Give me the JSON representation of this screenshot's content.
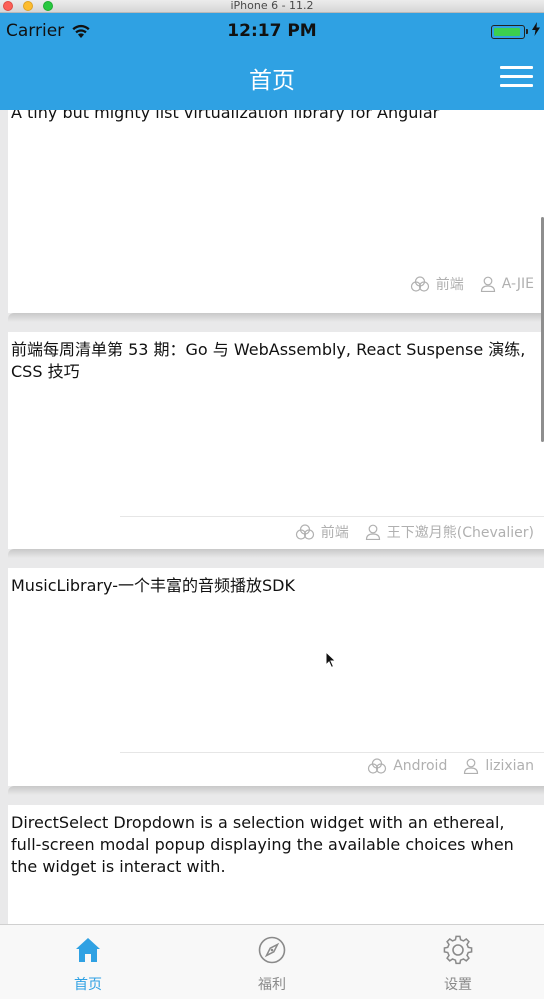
{
  "simulator": {
    "title": "iPhone 6 - 11.2"
  },
  "status_bar": {
    "carrier": "Carrier",
    "time": "12:17 PM"
  },
  "nav": {
    "title": "首页"
  },
  "articles": [
    {
      "title": "A tiny but mighty list virtualization library for Angular",
      "category": "前端",
      "author": "A-JIE"
    },
    {
      "title": "前端每周清单第 53 期：Go 与 WebAssembly, React Suspense 演练, CSS 技巧",
      "category": "前端",
      "author": "王下邀月熊(Chevalier)"
    },
    {
      "title": "MusicLibrary-一个丰富的音频播放SDK",
      "category": "Android",
      "author": "lizixian"
    },
    {
      "title": "DirectSelect Dropdown is a selection widget with an ethereal, full-screen modal popup displaying the available choices when the widget is interact with."
    }
  ],
  "tabs": [
    {
      "label": "首页",
      "icon": "home-icon",
      "active": true
    },
    {
      "label": "福利",
      "icon": "compass-icon",
      "active": false
    },
    {
      "label": "设置",
      "icon": "gear-icon",
      "active": false
    }
  ],
  "colors": {
    "accent": "#2fa1e3",
    "meta_gray": "#b0b0b0",
    "tab_inactive": "#8a8a8a"
  }
}
